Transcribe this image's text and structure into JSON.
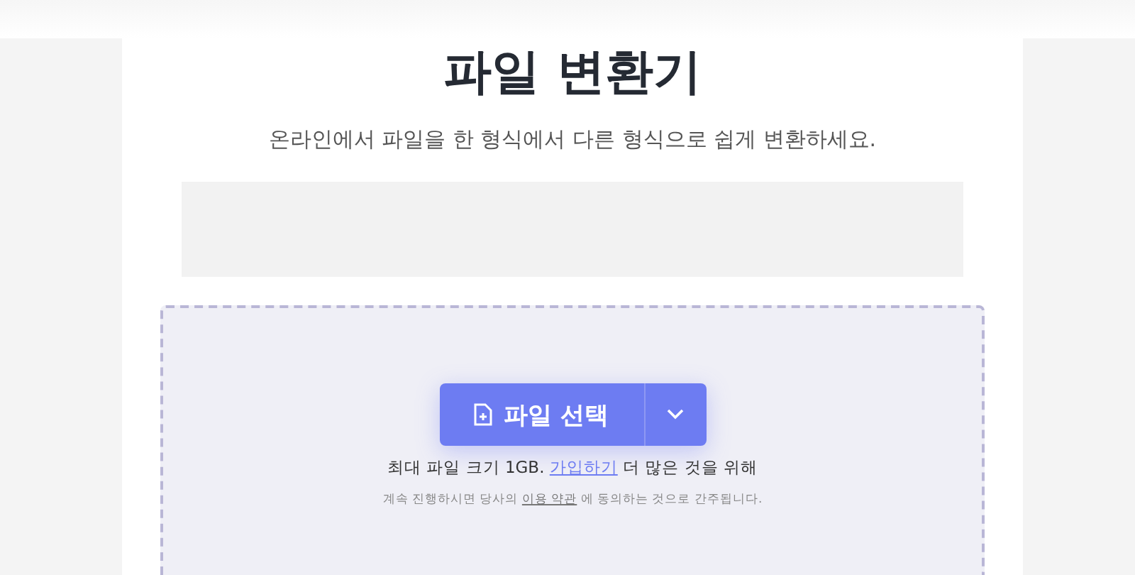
{
  "title": "파일 변환기",
  "subtitle": "온라인에서 파일을 한 형식에서 다른 형식으로 쉽게 변환하세요.",
  "upload": {
    "button": "파일 선택",
    "size_note": {
      "before": "최대 파일 크기 1GB.",
      "link": "가입하기",
      "after": "더 많은 것을 위해"
    },
    "terms_note": {
      "before": "계속 진행하시면 당사의",
      "link": "이용 약관",
      "after": "에 동의하는 것으로 간주됩니다."
    }
  }
}
